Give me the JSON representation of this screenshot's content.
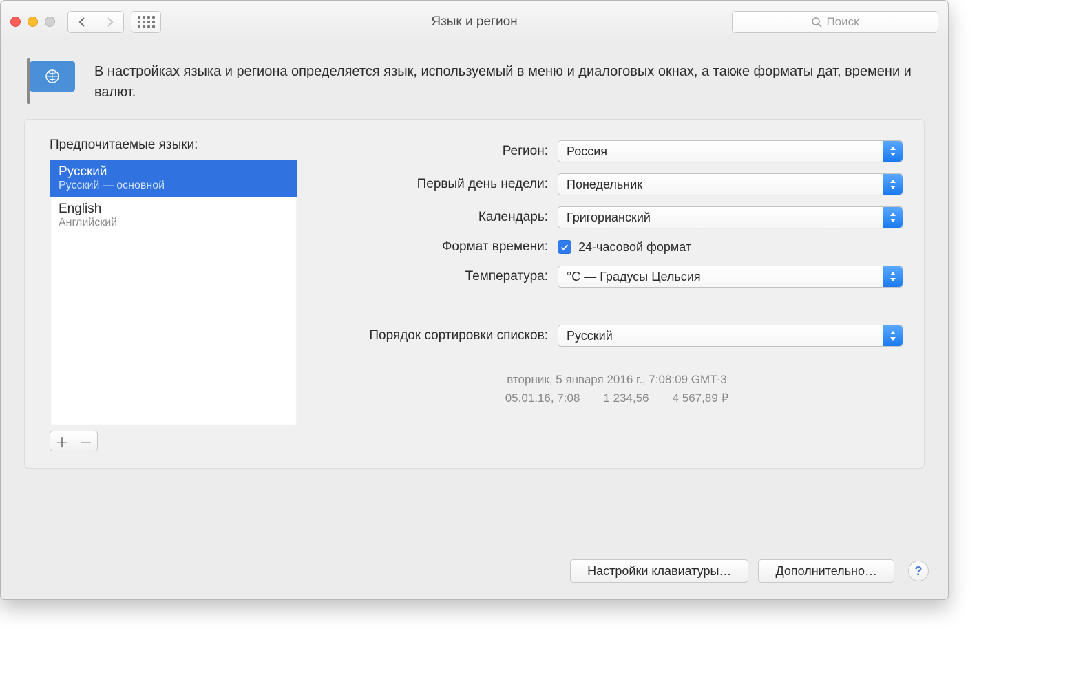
{
  "window": {
    "title": "Язык и регион"
  },
  "search": {
    "placeholder": "Поиск"
  },
  "header": {
    "description": "В настройках языка и региона определяется язык, используемый в меню и диалоговых окнах, а также форматы дат, времени и валют."
  },
  "languages": {
    "label": "Предпочитаемые языки:",
    "items": [
      {
        "name": "Русский",
        "sub": "Русский — основной",
        "selected": true
      },
      {
        "name": "English",
        "sub": "Английский",
        "selected": false
      }
    ]
  },
  "form": {
    "region": {
      "label": "Регион:",
      "value": "Россия"
    },
    "first_day": {
      "label": "Первый день недели:",
      "value": "Понедельник"
    },
    "calendar": {
      "label": "Календарь:",
      "value": "Григорианский"
    },
    "time_format": {
      "label": "Формат времени:",
      "checkbox_label": "24-часовой формат",
      "checked": true
    },
    "temperature": {
      "label": "Температура:",
      "value": "°C — Градусы Цельсия"
    },
    "sort_order": {
      "label": "Порядок сортировки списков:",
      "value": "Русский"
    }
  },
  "preview": {
    "line1": "вторник, 5 января 2016 г., 7:08:09 GMT-3",
    "short_date": "05.01.16, 7:08",
    "number": "1 234,56",
    "currency": "4 567,89 ₽"
  },
  "footer": {
    "keyboard": "Настройки клавиатуры…",
    "advanced": "Дополнительно…"
  }
}
